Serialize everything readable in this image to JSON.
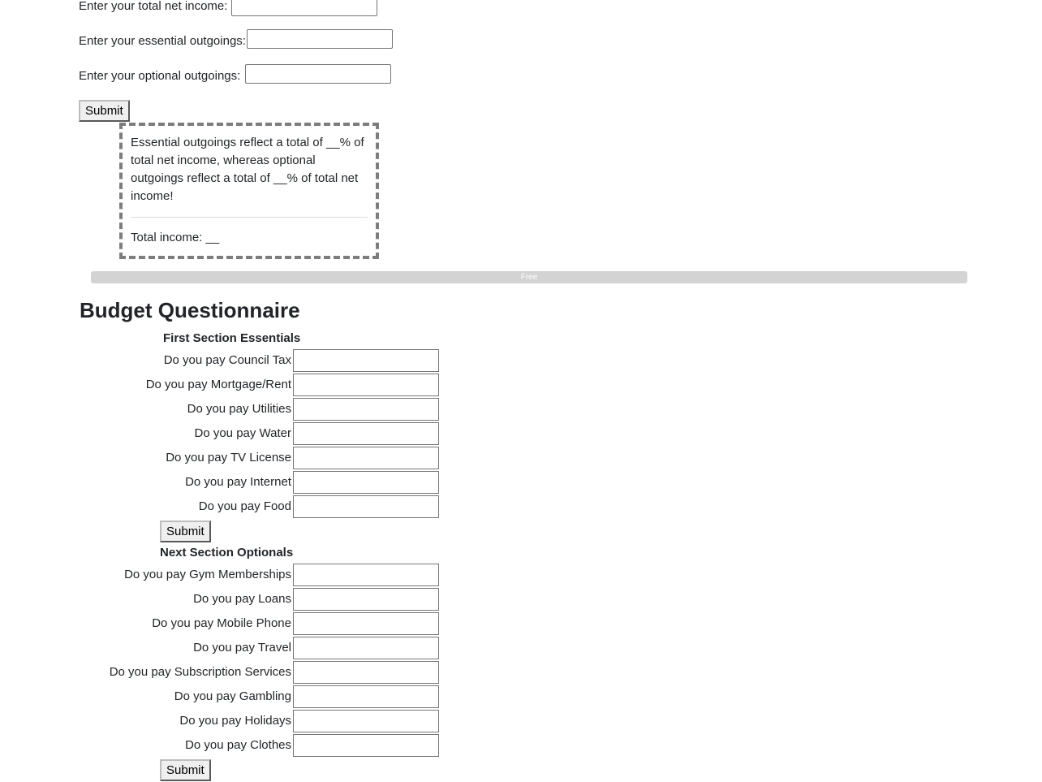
{
  "income_form": {
    "net_income_label": "Enter your total net income:",
    "net_income_value": "",
    "essential_label": "Enter your essential outgoings:",
    "essential_value": "",
    "optional_label": "Enter your optional outgoings:",
    "optional_value": "",
    "submit_label": "Submit"
  },
  "result": {
    "summary": "Essential outgoings reflect a total of __% of total net income, whereas optional outgoings reflect a total of __% of total net income!",
    "total_income": "Total income: __"
  },
  "progress": {
    "label": "Free",
    "value_percent": 100,
    "color": "#d3d3d3"
  },
  "questionnaire": {
    "title": "Budget Questionnaire",
    "essentials": {
      "heading": "First Section Essentials",
      "questions": [
        {
          "label": "Do you pay Council Tax",
          "value": ""
        },
        {
          "label": "Do you pay Mortgage/Rent",
          "value": ""
        },
        {
          "label": "Do you pay Utilities",
          "value": ""
        },
        {
          "label": "Do you pay Water",
          "value": ""
        },
        {
          "label": "Do you pay TV License",
          "value": ""
        },
        {
          "label": "Do you pay Internet",
          "value": ""
        },
        {
          "label": "Do you pay Food",
          "value": ""
        }
      ],
      "submit_label": "Submit"
    },
    "optionals": {
      "heading": "Next Section Optionals",
      "questions": [
        {
          "label": "Do you pay Gym Memberships",
          "value": ""
        },
        {
          "label": "Do you pay Loans",
          "value": ""
        },
        {
          "label": "Do you pay Mobile Phone",
          "value": ""
        },
        {
          "label": "Do you pay Travel",
          "value": ""
        },
        {
          "label": "Do you pay Subscription Services",
          "value": ""
        },
        {
          "label": "Do you pay Gambling",
          "value": ""
        },
        {
          "label": "Do you pay Holidays",
          "value": ""
        },
        {
          "label": "Do you pay Clothes",
          "value": ""
        }
      ],
      "submit_label": "Submit"
    }
  }
}
